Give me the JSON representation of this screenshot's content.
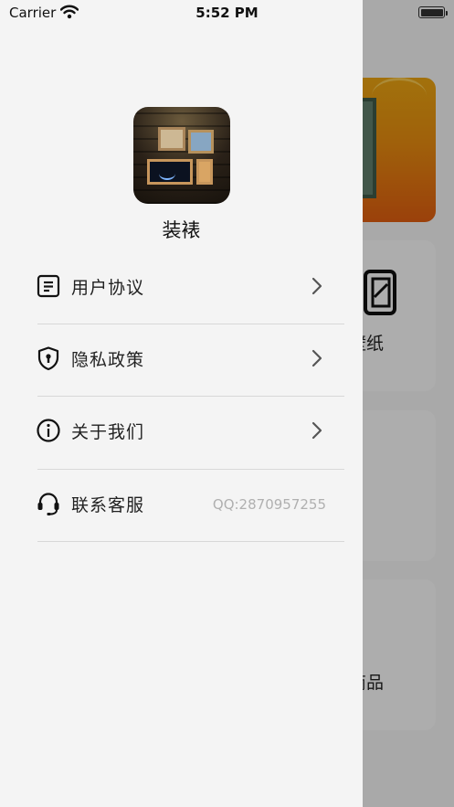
{
  "status_bar": {
    "carrier": "Carrier",
    "time": "5:52 PM"
  },
  "background": {
    "label_1": "壁纸",
    "label_2": "商品"
  },
  "drawer": {
    "app_name": "装裱",
    "menu": [
      {
        "label": "用户协议",
        "icon": "document-icon",
        "chevron": true
      },
      {
        "label": "隐私政策",
        "icon": "shield-icon",
        "chevron": true
      },
      {
        "label": "关于我们",
        "icon": "info-icon",
        "chevron": true
      },
      {
        "label": "联系客服",
        "icon": "headset-icon",
        "value": "QQ:2870957255"
      }
    ]
  },
  "colors": {
    "drawer_bg": "#f4f4f4",
    "divider": "#d8d8d8",
    "value_text": "#b0b0b0",
    "banner_orange": "#e58b10"
  }
}
